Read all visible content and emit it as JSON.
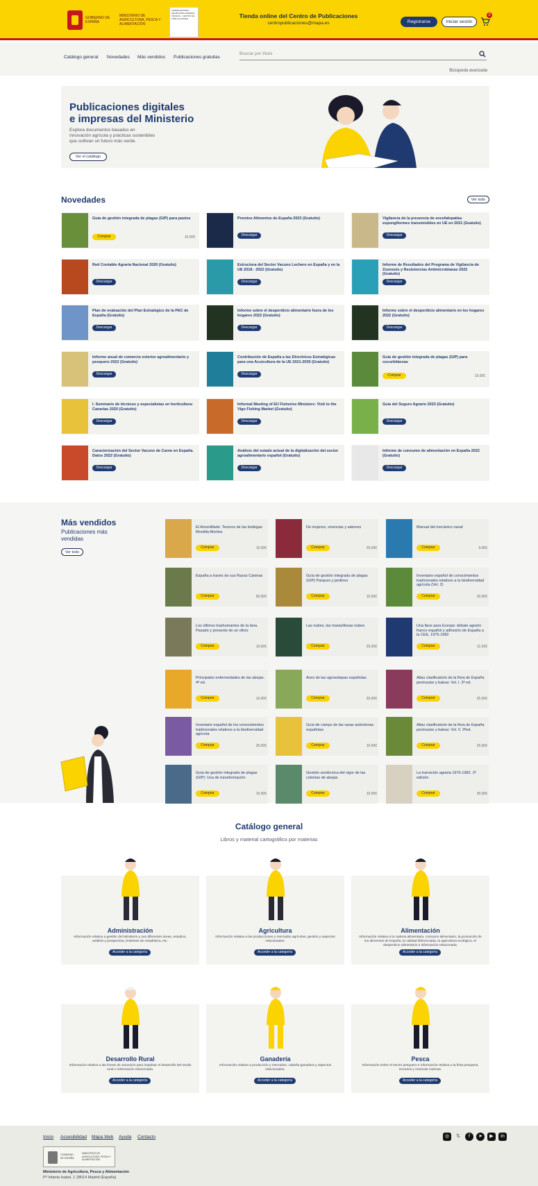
{
  "header": {
    "gov": "GOBIERNO DE ESPAÑA",
    "ministry": "MINISTERIO DE AGRICULTURA, PESCA Y ALIMENTACIÓN",
    "subsec": "SUBSECRETARÍA · SECRETARÍA GENERAL TÉCNICA · CENTRO DE PUBLICACIONES",
    "title": "Tienda online del Centro de Publicaciones",
    "email": "centropublicaciones@mapa.es",
    "register": "Registrarse",
    "login": "Iniciar sesión",
    "cart_count": "0",
    "cart_icon": "cart-icon"
  },
  "nav": {
    "links": [
      "Catálogo general",
      "Novedades",
      "Más vendidos",
      "Publicaciones gratuitas"
    ],
    "search_placeholder": "Buscar por título",
    "advanced": "Búsqueda avanzada"
  },
  "hero": {
    "title1": "Publicaciones digitales",
    "title2": "e impresas del Ministerio",
    "text1": "Explora documentos basados en",
    "text2": "innovación agrícola y prácticas sostenibles",
    "text3": "que cultivan un futuro más verde.",
    "button": "Ver el catálogo"
  },
  "novedades": {
    "title": "Novedades",
    "see_all": "Ver todo",
    "items": [
      {
        "title": "Guía de gestión integrada de plagas (GIP) para pastos",
        "action": "Comprar",
        "price": "15.00€",
        "thumb": "#6a8f3a"
      },
      {
        "title": "Premios Alimentos de España 2023 (Gratuito)",
        "action": "Descargar",
        "price": "",
        "thumb": "#1c2a4a"
      },
      {
        "title": "Vigilancia de la presencia de encefalopatías espongiformes transmisibles en UE en 2021 (Gratuito)",
        "action": "Descargar",
        "price": "",
        "thumb": "#c9b98a"
      },
      {
        "title": "Red Contable Agraria Nacional 2020 (Gratuito)",
        "action": "Descargar",
        "price": "",
        "thumb": "#b8481e"
      },
      {
        "title": "Estructura del Sector Vacuno Lechero en España y en la UE 2018 - 2022 (Gratuito)",
        "action": "Descargar",
        "price": "",
        "thumb": "#2a9aa8"
      },
      {
        "title": "Informe de Resultados del Programa de Vigilancia de Zoonosis y Resistencias Antimicrobianas 2022 (Gratuito)",
        "action": "Descargar",
        "price": "",
        "thumb": "#2aa0b8"
      },
      {
        "title": "Plan de evaluación del Plan Estratégico de la PAC de España (Gratuito)",
        "action": "Descargar",
        "price": "",
        "thumb": "#6f95c8"
      },
      {
        "title": "Informe sobre el desperdicio alimentario fuera de los hogares 2022 (Gratuito)",
        "action": "Descargar",
        "price": "",
        "thumb": "#223322"
      },
      {
        "title": "Informe sobre el desperdicio alimentario en los hogares 2022 (Gratuito)",
        "action": "Descargar",
        "price": "",
        "thumb": "#223322"
      },
      {
        "title": "Informe anual de comercio exterior agroalimentario y pesquero 2022 (Gratuito)",
        "action": "Descargar",
        "price": "",
        "thumb": "#d8c27a"
      },
      {
        "title": "Contribución de España a las Directrices Estratégicas para una Acuicultura de la UE 2021-2030 (Gratuito)",
        "action": "Descargar",
        "price": "",
        "thumb": "#1f7f9a"
      },
      {
        "title": "Guía de gestión integrada de plagas (GIP) para cucurbitáceas",
        "action": "Comprar",
        "price": "15.00€",
        "thumb": "#5a8a3a"
      },
      {
        "title": "I. Seminario de técnicos y especialistas en horticultura: Canarias 2020 (Gratuito)",
        "action": "Descargar",
        "price": "",
        "thumb": "#e8c23a"
      },
      {
        "title": "Informal Meeting of EU Fisheries Ministers: Visit to the Vigo Fishing Market (Gratuito)",
        "action": "Descargar",
        "price": "",
        "thumb": "#c86a2a"
      },
      {
        "title": "Guía del Seguro Agrario 2023 (Gratuito)",
        "action": "Descargar",
        "price": "",
        "thumb": "#7ab04a"
      },
      {
        "title": "Caracterización del Sector Vacuno de Carne en España. Datos 2022 (Gratuito)",
        "action": "Descargar",
        "price": "",
        "thumb": "#c84a2a"
      },
      {
        "title": "Análisis del estado actual de la digitalización del sector agroalimentario español (Gratuito)",
        "action": "Descargar",
        "price": "",
        "thumb": "#2a9a8a"
      },
      {
        "title": "Informe de consumo de alimentación en España 2022 (Gratuito)",
        "action": "Descargar",
        "price": "",
        "thumb": "#e8e8e8"
      }
    ]
  },
  "mas_vendidos": {
    "title": "Más vendidos",
    "subtitle1": "Publicaciones más",
    "subtitle2": "vendidas",
    "see_all": "Ver todo",
    "items": [
      {
        "title": "El Amontillado. Tesoros de las bodegas Montilla-Moriles",
        "action": "Comprar",
        "price": "15.00€",
        "thumb": "#d8a84a"
      },
      {
        "title": "De mujeres, vivencias y sabores",
        "action": "Comprar",
        "price": "25.00€",
        "thumb": "#8a2a3a"
      },
      {
        "title": "Manual del mecánico naval",
        "action": "Comprar",
        "price": "9.00€",
        "thumb": "#2a7ab0"
      },
      {
        "title": "España a través de sus Razas Caninas",
        "action": "Comprar",
        "price": "50.00€",
        "thumb": "#6a7a4a"
      },
      {
        "title": "Guía de gestión integrada de plagas (GIP) Parques y jardines",
        "action": "Comprar",
        "price": "15.00€",
        "thumb": "#a88a3a"
      },
      {
        "title": "Inventario español de conocimientos tradicionales relativos a la biodiversidad agrícola (Vol. 2)",
        "action": "Comprar",
        "price": "20.00€",
        "thumb": "#5a8a3a"
      },
      {
        "title": "Los últimos trashumantes de la lana. Pasado y presente de un oficio",
        "action": "Comprar",
        "price": "10.00€",
        "thumb": "#7a7a5a"
      },
      {
        "title": "Las nubes, las maravillosas nubes",
        "action": "Comprar",
        "price": "25.00€",
        "thumb": "#2a4a3a"
      },
      {
        "title": "Una llave para Europa: debate agrario franco-español y adhesión de España a la CEE, 1975-1982",
        "action": "Comprar",
        "price": "11.00€",
        "thumb": "#1e3a70"
      },
      {
        "title": "Principales enfermedades de las abejas. 4ª ed.",
        "action": "Comprar",
        "price": "10.00€",
        "thumb": "#e8a82a"
      },
      {
        "title": "Aves de las agroestepas españolas",
        "action": "Comprar",
        "price": "30.00€",
        "thumb": "#8aa85a"
      },
      {
        "title": "Atlas clasificatorio de la flora de España peninsular y balear. Vol. I. 3ª ed.",
        "action": "Comprar",
        "price": "25.00€",
        "thumb": "#8a3a5a"
      },
      {
        "title": "Inventario español de los conocimientos tradicionales relativos a la biodiversidad agrícola",
        "action": "Comprar",
        "price": "20.00€",
        "thumb": "#7a5aa0"
      },
      {
        "title": "Guía de campo de las razas autóctonas españolas",
        "action": "Comprar",
        "price": "15.00€",
        "thumb": "#e8c23a"
      },
      {
        "title": "Atlas clasificatorio de la flora de España peninsular y balear. Vol. II. 3ªed.",
        "action": "Comprar",
        "price": "25.00€",
        "thumb": "#6a8a3a"
      },
      {
        "title": "Guía de gestión integrada de plagas (GIP): Uva de transformación",
        "action": "Comprar",
        "price": "15.00€",
        "thumb": "#4a6a8a"
      },
      {
        "title": "Gestión zootécnica del vigor de las colonias de abejas",
        "action": "Comprar",
        "price": "10.00€",
        "thumb": "#5a8a6a"
      },
      {
        "title": "La transición agraria 1976-1982. 2ª edición",
        "action": "Comprar",
        "price": "30.00€",
        "thumb": "#d8d0c0"
      }
    ]
  },
  "catalogo": {
    "title": "Catálogo general",
    "subtitle": "Libros y material cartográfico por materias",
    "button": "Acceder a la categoría",
    "cats": [
      {
        "name": "Administración",
        "desc": "Información relativa a gestión del Ministerio y sus diferentes áreas, estudios, análisis y prospectiva, boletines de estadística, etc."
      },
      {
        "name": "Agricultura",
        "desc": "Información relativa a las producciones y mercados agrícolas, gestión y aspectos relacionados."
      },
      {
        "name": "Alimentación",
        "desc": "Información relativa a la cadena alimentaria, consumo alimentario, la promoción de los alimentos de España, la calidad diferenciada, la agricultura ecológica, el desperdicio alimentario e información relacionada."
      },
      {
        "name": "Desarrollo Rural",
        "desc": "Información relativa a las líneas de actuación para impulsar el desarrollo del medio rural e información relacionada."
      },
      {
        "name": "Ganadería",
        "desc": "Información relativa a producción y mercados, cabaña ganadera y aspectos relacionados."
      },
      {
        "name": "Pesca",
        "desc": "Información sobre el sector pesquero e información relativa a la flota pesquera, recursos y reservas marinas."
      }
    ]
  },
  "footer": {
    "links": [
      "Inicio",
      "Accesibilidad",
      "Mapa Web",
      "Ayuda",
      "Contacto"
    ],
    "org": "Ministerio de Agricultura, Pesca y Alimentación",
    "address": "Pº Infanta Isabel, 1 28014 Madrid (España)",
    "social": [
      "instagram-icon",
      "x-icon",
      "facebook-icon",
      "telegram-icon",
      "youtube-icon",
      "linkedin-icon"
    ]
  }
}
